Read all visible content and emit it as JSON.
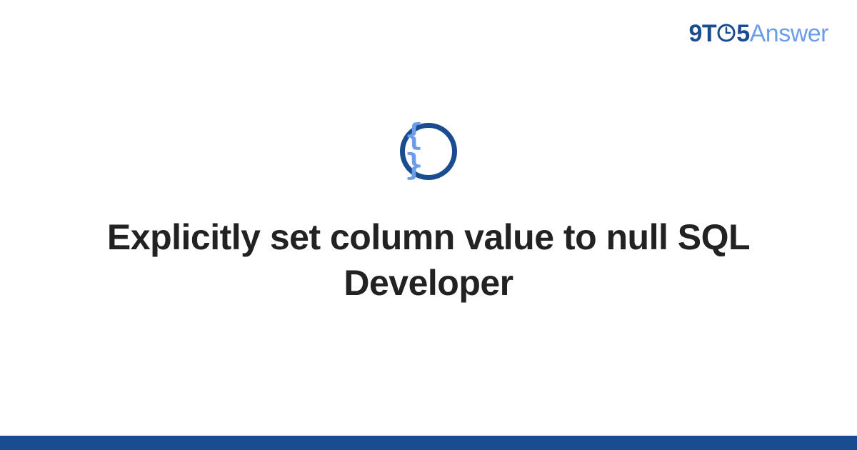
{
  "brand": {
    "nine": "9",
    "t": "T",
    "five": "5",
    "answer": "Answer"
  },
  "icon": {
    "braces": "{ }"
  },
  "title": "Explicitly set column value to null SQL Developer"
}
